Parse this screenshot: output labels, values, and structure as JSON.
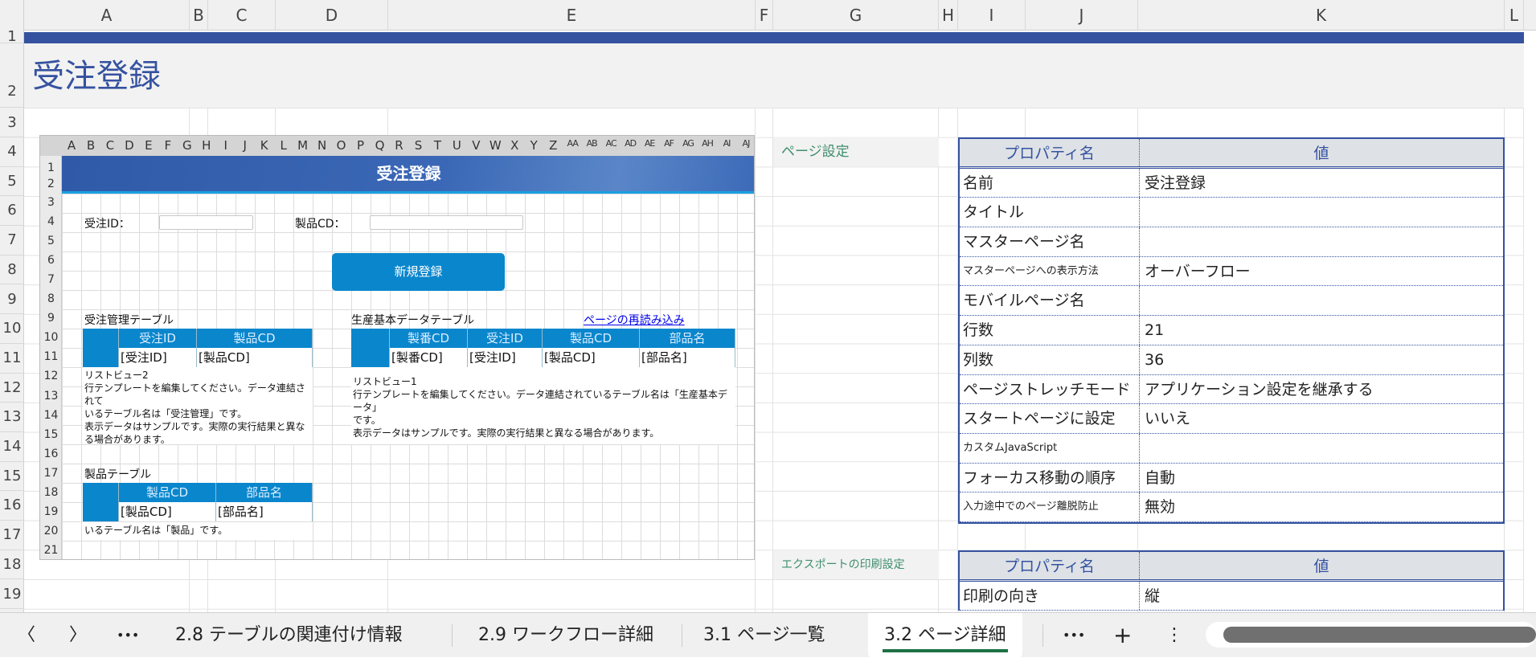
{
  "sheet": {
    "columns": [
      {
        "label": "A"
      },
      {
        "label": "B"
      },
      {
        "label": "C"
      },
      {
        "label": "D"
      },
      {
        "label": "E"
      },
      {
        "label": "F"
      },
      {
        "label": "G"
      },
      {
        "label": "H"
      },
      {
        "label": "I"
      },
      {
        "label": "J"
      },
      {
        "label": "K"
      },
      {
        "label": "L"
      }
    ],
    "rows": [
      "1",
      "2",
      "3",
      "4",
      "5",
      "6",
      "7",
      "8",
      "9",
      "10",
      "11",
      "12",
      "13",
      "14",
      "15",
      "16",
      "17",
      "18",
      "19"
    ],
    "title": "受注登録"
  },
  "preview": {
    "columns": [
      "A",
      "B",
      "C",
      "D",
      "E",
      "F",
      "G",
      "H",
      "I",
      "J",
      "K",
      "L",
      "M",
      "N",
      "O",
      "P",
      "Q",
      "R",
      "S",
      "T",
      "U",
      "V",
      "W",
      "X",
      "Y",
      "Z",
      "AA",
      "AB",
      "AC",
      "AD",
      "AE",
      "AF",
      "AG",
      "AH",
      "AI",
      "AJ"
    ],
    "rows": [
      "1",
      "2",
      "3",
      "4",
      "5",
      "6",
      "7",
      "8",
      "9",
      "10",
      "11",
      "12",
      "13",
      "14",
      "15",
      "16",
      "17",
      "18",
      "19",
      "20",
      "21"
    ],
    "banner": "受注登録",
    "order_id_label": "受注ID：",
    "product_cd_label": "製品CD：",
    "new_button": "新規登録",
    "table1": {
      "title": "受注管理テーブル",
      "headers": [
        "受注ID",
        "製品CD"
      ],
      "cells": [
        "[受注ID]",
        "[製品CD]"
      ],
      "note": [
        "リストビュー2",
        "行テンプレートを編集してください。データ連結されて",
        "いるテーブル名は「受注管理」です。",
        "表示データはサンプルです。実際の実行結果と異な",
        "る場合があります。"
      ]
    },
    "table2": {
      "title": "生産基本データテーブル",
      "link": "ページの再読み込み",
      "headers": [
        "製番CD",
        "受注ID",
        "製品CD",
        "部品名"
      ],
      "cells": [
        "[製番CD]",
        "[受注ID]",
        "[製品CD]",
        "[部品名]"
      ],
      "note": [
        "リストビュー1",
        "行テンプレートを編集してください。データ連結されているテーブル名は「生産基本データ」",
        "です。",
        "表示データはサンプルです。実際の実行結果と異なる場合があります。"
      ]
    },
    "table3": {
      "title": "製品テーブル",
      "headers": [
        "製品CD",
        "部品名"
      ],
      "cells": [
        "[製品CD]",
        "[部品名]"
      ],
      "note": "いるテーブル名は「製品」です。"
    }
  },
  "page_settings": {
    "section": "ページ設定",
    "header": {
      "key": "プロパティ名",
      "value": "値"
    },
    "rows": [
      {
        "key": "名前",
        "value": "受注登録"
      },
      {
        "key": "タイトル",
        "value": ""
      },
      {
        "key": "マスターページ名",
        "value": ""
      },
      {
        "key": "マスターページへの表示方法",
        "value": "オーバーフロー"
      },
      {
        "key": "モバイルページ名",
        "value": ""
      },
      {
        "key": "行数",
        "value": "21"
      },
      {
        "key": "列数",
        "value": "36"
      },
      {
        "key": "ページストレッチモード",
        "value": "アプリケーション設定を継承する"
      },
      {
        "key": "スタートページに設定",
        "value": "いいえ"
      },
      {
        "key": "カスタムJavaScript",
        "value": ""
      },
      {
        "key": "フォーカス移動の順序",
        "value": "自動"
      },
      {
        "key": "入力途中でのページ離脱防止",
        "value": "無効"
      }
    ]
  },
  "export_settings": {
    "section": "エクスポートの印刷設定",
    "header": {
      "key": "プロパティ名",
      "value": "値"
    },
    "rows": [
      {
        "key": "印刷の向き",
        "value": "縦"
      }
    ]
  },
  "tabs": {
    "prev": "〈",
    "next": "〉",
    "more": "•••",
    "items": [
      {
        "label": "2.8 テーブルの関連付け情報"
      },
      {
        "label": "2.9 ワークフロー詳細"
      },
      {
        "label": "3.1 ページ一覧"
      },
      {
        "label": "3.2 ページ詳細"
      }
    ],
    "more_right": "•••",
    "add": "+",
    "menu": "⋮"
  },
  "colors": {
    "accent": "#3552a0",
    "button": "#0a86cc",
    "active_tab": "#1e7145"
  }
}
